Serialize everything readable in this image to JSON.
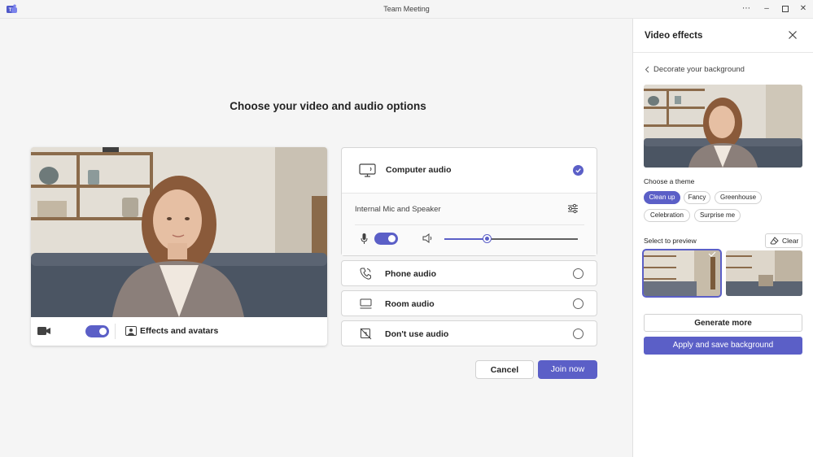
{
  "window": {
    "title": "Team Meeting",
    "more_icon": "ellipsis-icon",
    "minimize_icon": "minimize-icon",
    "maximize_icon": "maximize-icon",
    "close_icon": "close-icon"
  },
  "main": {
    "heading": "Choose your video and audio options",
    "video": {
      "camera_on": true,
      "effects_label": "Effects and avatars"
    },
    "audio": {
      "computer_audio": {
        "label": "Computer audio",
        "selected": true,
        "device": "Internal Mic and Speaker",
        "mic_on": true,
        "speaker_volume": 0.32
      },
      "options": [
        {
          "label": "Phone audio",
          "icon": "phone-icon",
          "selected": false
        },
        {
          "label": "Room audio",
          "icon": "room-icon",
          "selected": false
        },
        {
          "label": "Don't use audio",
          "icon": "no-audio-icon",
          "selected": false
        }
      ]
    },
    "buttons": {
      "cancel": "Cancel",
      "join": "Join now"
    }
  },
  "side": {
    "title": "Video effects",
    "back_label": "Decorate your background",
    "theme_label": "Choose a theme",
    "themes": [
      {
        "label": "Clean up",
        "selected": true
      },
      {
        "label": "Fancy",
        "selected": false
      },
      {
        "label": "Greenhouse",
        "selected": false
      },
      {
        "label": "Celebration",
        "selected": false
      },
      {
        "label": "Surprise me",
        "selected": false
      }
    ],
    "preview_label": "Select to preview",
    "clear_label": "Clear",
    "thumbnails_selected_index": 0,
    "generate_more": "Generate more",
    "apply_save": "Apply and save background"
  },
  "colors": {
    "accent": "#5b5fc7",
    "background": "#f5f5f5"
  }
}
